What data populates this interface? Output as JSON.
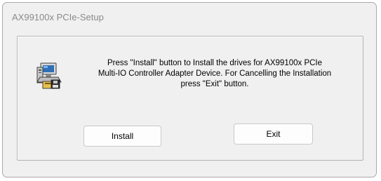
{
  "window": {
    "title": "AX99100x PCIe-Setup"
  },
  "dialog": {
    "icon": "setup-computer-icon",
    "message_line1": "Press \"Install\" button to Install the drives for AX99100x PCIe",
    "message_line2": "Multi-IO Controller Adapter Device. For Cancelling the Installation",
    "message_line3": "press \"Exit\" button."
  },
  "buttons": {
    "install_label": "Install",
    "exit_label": "Exit"
  }
}
